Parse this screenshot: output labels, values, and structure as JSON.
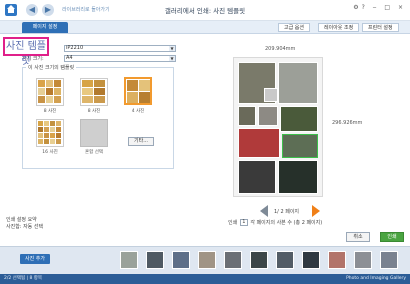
{
  "window": {
    "title": "갤러리에서 인쇄: 사진 템플릿",
    "breadcrumb": "라이브러리로 돌아가기",
    "controls": "⚙? ‒ □ ×"
  },
  "tabs": {
    "active": "페이지 설정",
    "right": [
      "고급 옵션",
      "레이아웃 조정",
      "프린터 설정"
    ]
  },
  "left": {
    "highlight_label": "사진 템플릿",
    "printer_value": "iP2210",
    "paper_label": "용지 크기:",
    "paper_value": "A4",
    "template_group": "이 사진 크기의 템플릿",
    "templates": [
      {
        "label": "8 사진"
      },
      {
        "label": "8 사진"
      },
      {
        "label": "4 사진"
      },
      {
        "label": "16 사진"
      },
      {
        "label": "혼합 선택"
      }
    ],
    "more_button": "기타...",
    "summary_line1": "인쇄 설정 요약",
    "summary_line2": "사진합: 자동 선택"
  },
  "preview": {
    "width_label": "209.904mm",
    "height_label": "296.926mm",
    "page_text": "1/ 2 페이지",
    "copies_prefix": "인쇄",
    "copies_value": "1",
    "copies_suffix": "각 페이지의 사본 수 (총 2 페이지)"
  },
  "buttons": {
    "cancel": "취소",
    "print": "인쇄"
  },
  "filmstrip": {
    "add_label": "사진 추가"
  },
  "status": {
    "left": "2/2 선택됨 | 8 항목",
    "right": "Photo and Imaging Gallery"
  }
}
